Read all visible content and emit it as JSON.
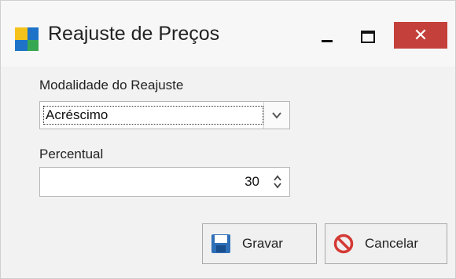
{
  "window": {
    "title": "Reajuste de Preços",
    "icons": {
      "app": "app-icon",
      "minimize": "minimize-icon",
      "maximize": "maximize-icon",
      "close": "close-icon"
    },
    "close_glyph": "✕",
    "close_color": "#c4403a"
  },
  "form": {
    "modalidade_label": "Modalidade do Reajuste",
    "modalidade_value": "Acréscimo",
    "percentual_label": "Percentual",
    "percentual_value": "30"
  },
  "buttons": {
    "save_label": "Gravar",
    "cancel_label": "Cancelar",
    "save_icon": "floppy-disk-icon",
    "cancel_icon": "no-entry-icon"
  }
}
